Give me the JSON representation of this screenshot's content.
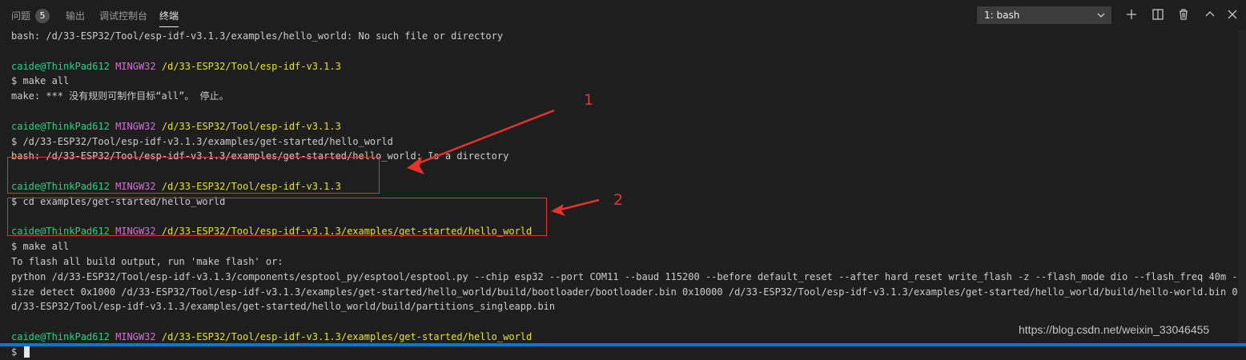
{
  "panel": {
    "tabs": [
      {
        "label": "问题",
        "active": false
      },
      {
        "label": "输出",
        "active": false
      },
      {
        "label": "调试控制台",
        "active": false
      },
      {
        "label": "终端",
        "active": true
      }
    ],
    "problems_count": "5",
    "terminal_select": "1: bash",
    "toolbar_icons": [
      "plus-icon",
      "split-icon",
      "trash-icon",
      "chevron-up-icon",
      "close-icon"
    ]
  },
  "terminal": {
    "lines": [
      {
        "text": "bash: /d/33-ESP32/Tool/esp-idf-v3.1.3/examples/hello_world: No such file or directory"
      },
      {
        "text": ""
      },
      {
        "prompt": {
          "user": "caide@ThinkPad612",
          "shell": "MINGW32",
          "path": "/d/33-ESP32/Tool/esp-idf-v3.1.3"
        }
      },
      {
        "text": "$ make all"
      },
      {
        "text": "make: *** 没有规则可制作目标“all”。 停止。"
      },
      {
        "text": ""
      },
      {
        "prompt": {
          "user": "caide@ThinkPad612",
          "shell": "MINGW32",
          "path": "/d/33-ESP32/Tool/esp-idf-v3.1.3"
        }
      },
      {
        "text": "$ /d/33-ESP32/Tool/esp-idf-v3.1.3/examples/get-started/hello_world"
      },
      {
        "text": "bash: /d/33-ESP32/Tool/esp-idf-v3.1.3/examples/get-started/hello_world: Is a directory"
      },
      {
        "text": ""
      },
      {
        "prompt": {
          "user": "caide@ThinkPad612",
          "shell": "MINGW32",
          "path": "/d/33-ESP32/Tool/esp-idf-v3.1.3"
        }
      },
      {
        "text": "$ cd examples/get-started/hello_world"
      },
      {
        "text": ""
      },
      {
        "prompt": {
          "user": "caide@ThinkPad612",
          "shell": "MINGW32",
          "path": "/d/33-ESP32/Tool/esp-idf-v3.1.3/examples/get-started/hello_world"
        }
      },
      {
        "text": "$ make all"
      },
      {
        "text": "To flash all build output, run 'make flash' or:"
      },
      {
        "text": "python /d/33-ESP32/Tool/esp-idf-v3.1.3/components/esptool_py/esptool/esptool.py --chip esp32 --port COM11 --baud 115200 --before default_reset --after hard_reset write_flash -z --flash_mode dio --flash_freq 40m --flash_"
      },
      {
        "text": "size detect 0x1000 /d/33-ESP32/Tool/esp-idf-v3.1.3/examples/get-started/hello_world/build/bootloader/bootloader.bin 0x10000 /d/33-ESP32/Tool/esp-idf-v3.1.3/examples/get-started/hello_world/build/hello-world.bin 0x8000 /"
      },
      {
        "text": "d/33-ESP32/Tool/esp-idf-v3.1.3/examples/get-started/hello_world/build/partitions_singleapp.bin"
      },
      {
        "text": ""
      },
      {
        "prompt": {
          "user": "caide@ThinkPad612",
          "shell": "MINGW32",
          "path": "/d/33-ESP32/Tool/esp-idf-v3.1.3/examples/get-started/hello_world"
        }
      },
      {
        "text": "$ ",
        "cursor": true
      }
    ]
  },
  "annotations": {
    "label_1": "1",
    "label_2": "2",
    "color": "#e8332a"
  },
  "watermark": "https://blog.csdn.net/weixin_33046455",
  "colors": {
    "background": "#1e1e1e",
    "prompt_user": "#23d18b",
    "prompt_shell": "#d670d6",
    "prompt_path": "#e5e510",
    "accent": "#007acc"
  }
}
